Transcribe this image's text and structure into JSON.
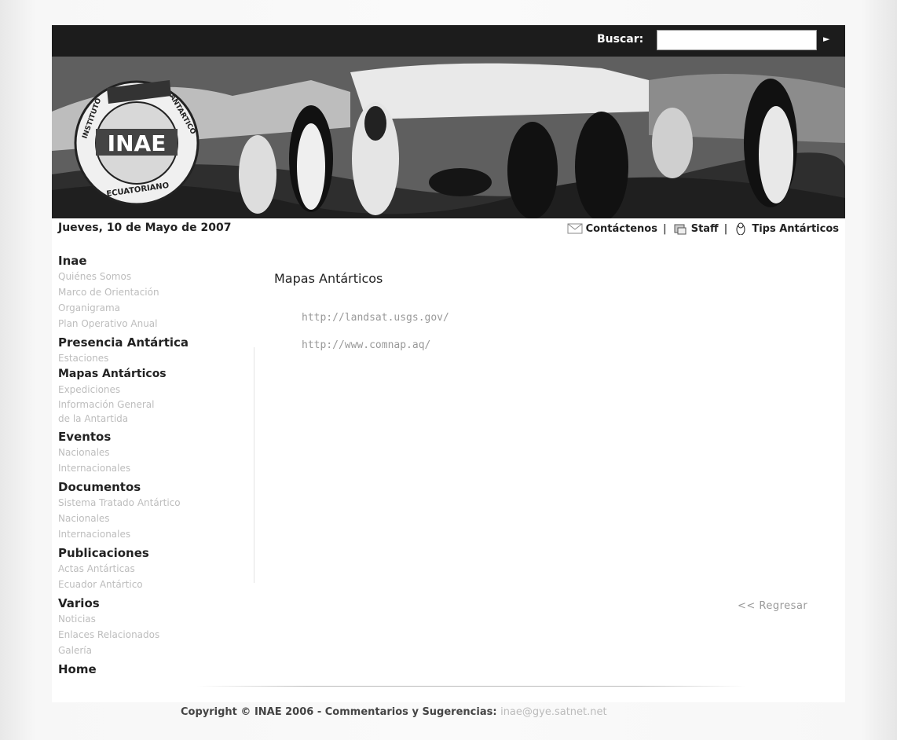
{
  "search": {
    "label": "Buscar:",
    "placeholder": "",
    "go_icon": "arrow-right-icon"
  },
  "banner": {
    "logo_text_main": "INAE",
    "logo_ring_top": "INSTITUTO ANTARTICO",
    "logo_ring_bottom": "ECUATORIANO"
  },
  "header": {
    "date": "Jueves, 10 de Mayo de 2007",
    "links": [
      {
        "label": "Contáctenos",
        "icon": "envelope-icon"
      },
      {
        "label": "Staff",
        "icon": "staff-icon"
      },
      {
        "label": "Tips Antárticos",
        "icon": "penguin-icon"
      }
    ],
    "separator": "|"
  },
  "sidebar": {
    "sections": [
      {
        "title": "Inae",
        "items": [
          "Quiénes Somos",
          "Marco de Orientación",
          "Organigrama",
          "Plan Operativo Anual"
        ]
      },
      {
        "title": "Presencia Antártica",
        "items": [
          "Estaciones"
        ]
      },
      {
        "title": "Mapas Antárticos",
        "items": [
          "Expediciones",
          "Información General",
          "de la Antartida"
        ]
      },
      {
        "title": "Eventos",
        "items": [
          "Nacionales",
          "Internacionales"
        ]
      },
      {
        "title": "Documentos",
        "items": [
          "Sistema Tratado Antártico",
          "Nacionales",
          "Internacionales"
        ]
      },
      {
        "title": "Publicaciones",
        "items": [
          "Actas Antárticas",
          "Ecuador Antártico"
        ]
      },
      {
        "title": "Varios",
        "items": [
          "Noticias",
          "Enlaces Relacionados",
          "Galería"
        ]
      },
      {
        "title": "Home",
        "items": []
      }
    ]
  },
  "main": {
    "title": "Mapas Antárticos",
    "links": [
      "http://landsat.usgs.gov/",
      "http://www.comnap.aq/"
    ],
    "back": "<< Regresar"
  },
  "footer": {
    "text": "Copyright © INAE 2006 - Commentarios y Sugerencias:",
    "email": "inae@gye.satnet.net"
  }
}
